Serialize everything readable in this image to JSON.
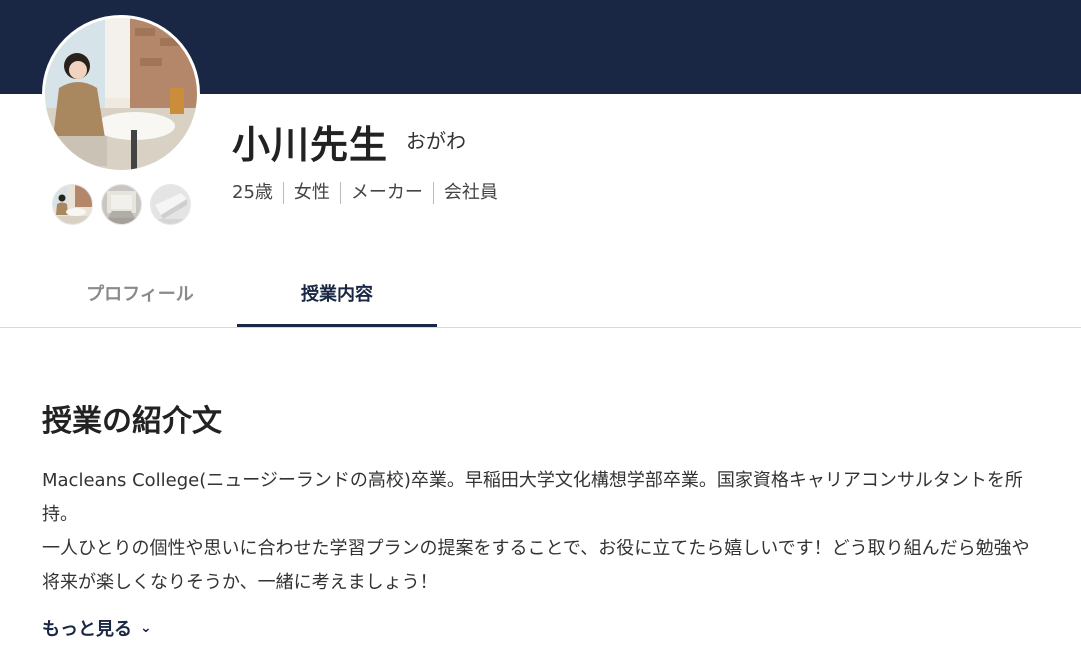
{
  "teacher": {
    "name": "小川先生",
    "kana": "おがわ",
    "tags": [
      "25歳",
      "女性",
      "メーカー",
      "会社員"
    ]
  },
  "tabs": [
    {
      "label": "プロフィール",
      "active": false
    },
    {
      "label": "授業内容",
      "active": true
    }
  ],
  "section": {
    "title": "授業の紹介文",
    "paragraphs": [
      "Macleans College(ニュージーランドの高校)卒業。早稲田大学文化構想学部卒業。国家資格キャリアコンサルタントを所持。",
      "一人ひとりの個性や思いに合わせた学習プランの提案をすることで、お役に立てたら嬉しいです！どう取り組んだら勉強や将来が楽しくなりそうか、一緒に考えましょう！"
    ],
    "more_label": "もっと見る",
    "more_icon": "chevron-down-icon"
  },
  "colors": {
    "banner": "#1a2744",
    "accent": "#1a2744",
    "inactive_tab": "#8a8a8a"
  }
}
